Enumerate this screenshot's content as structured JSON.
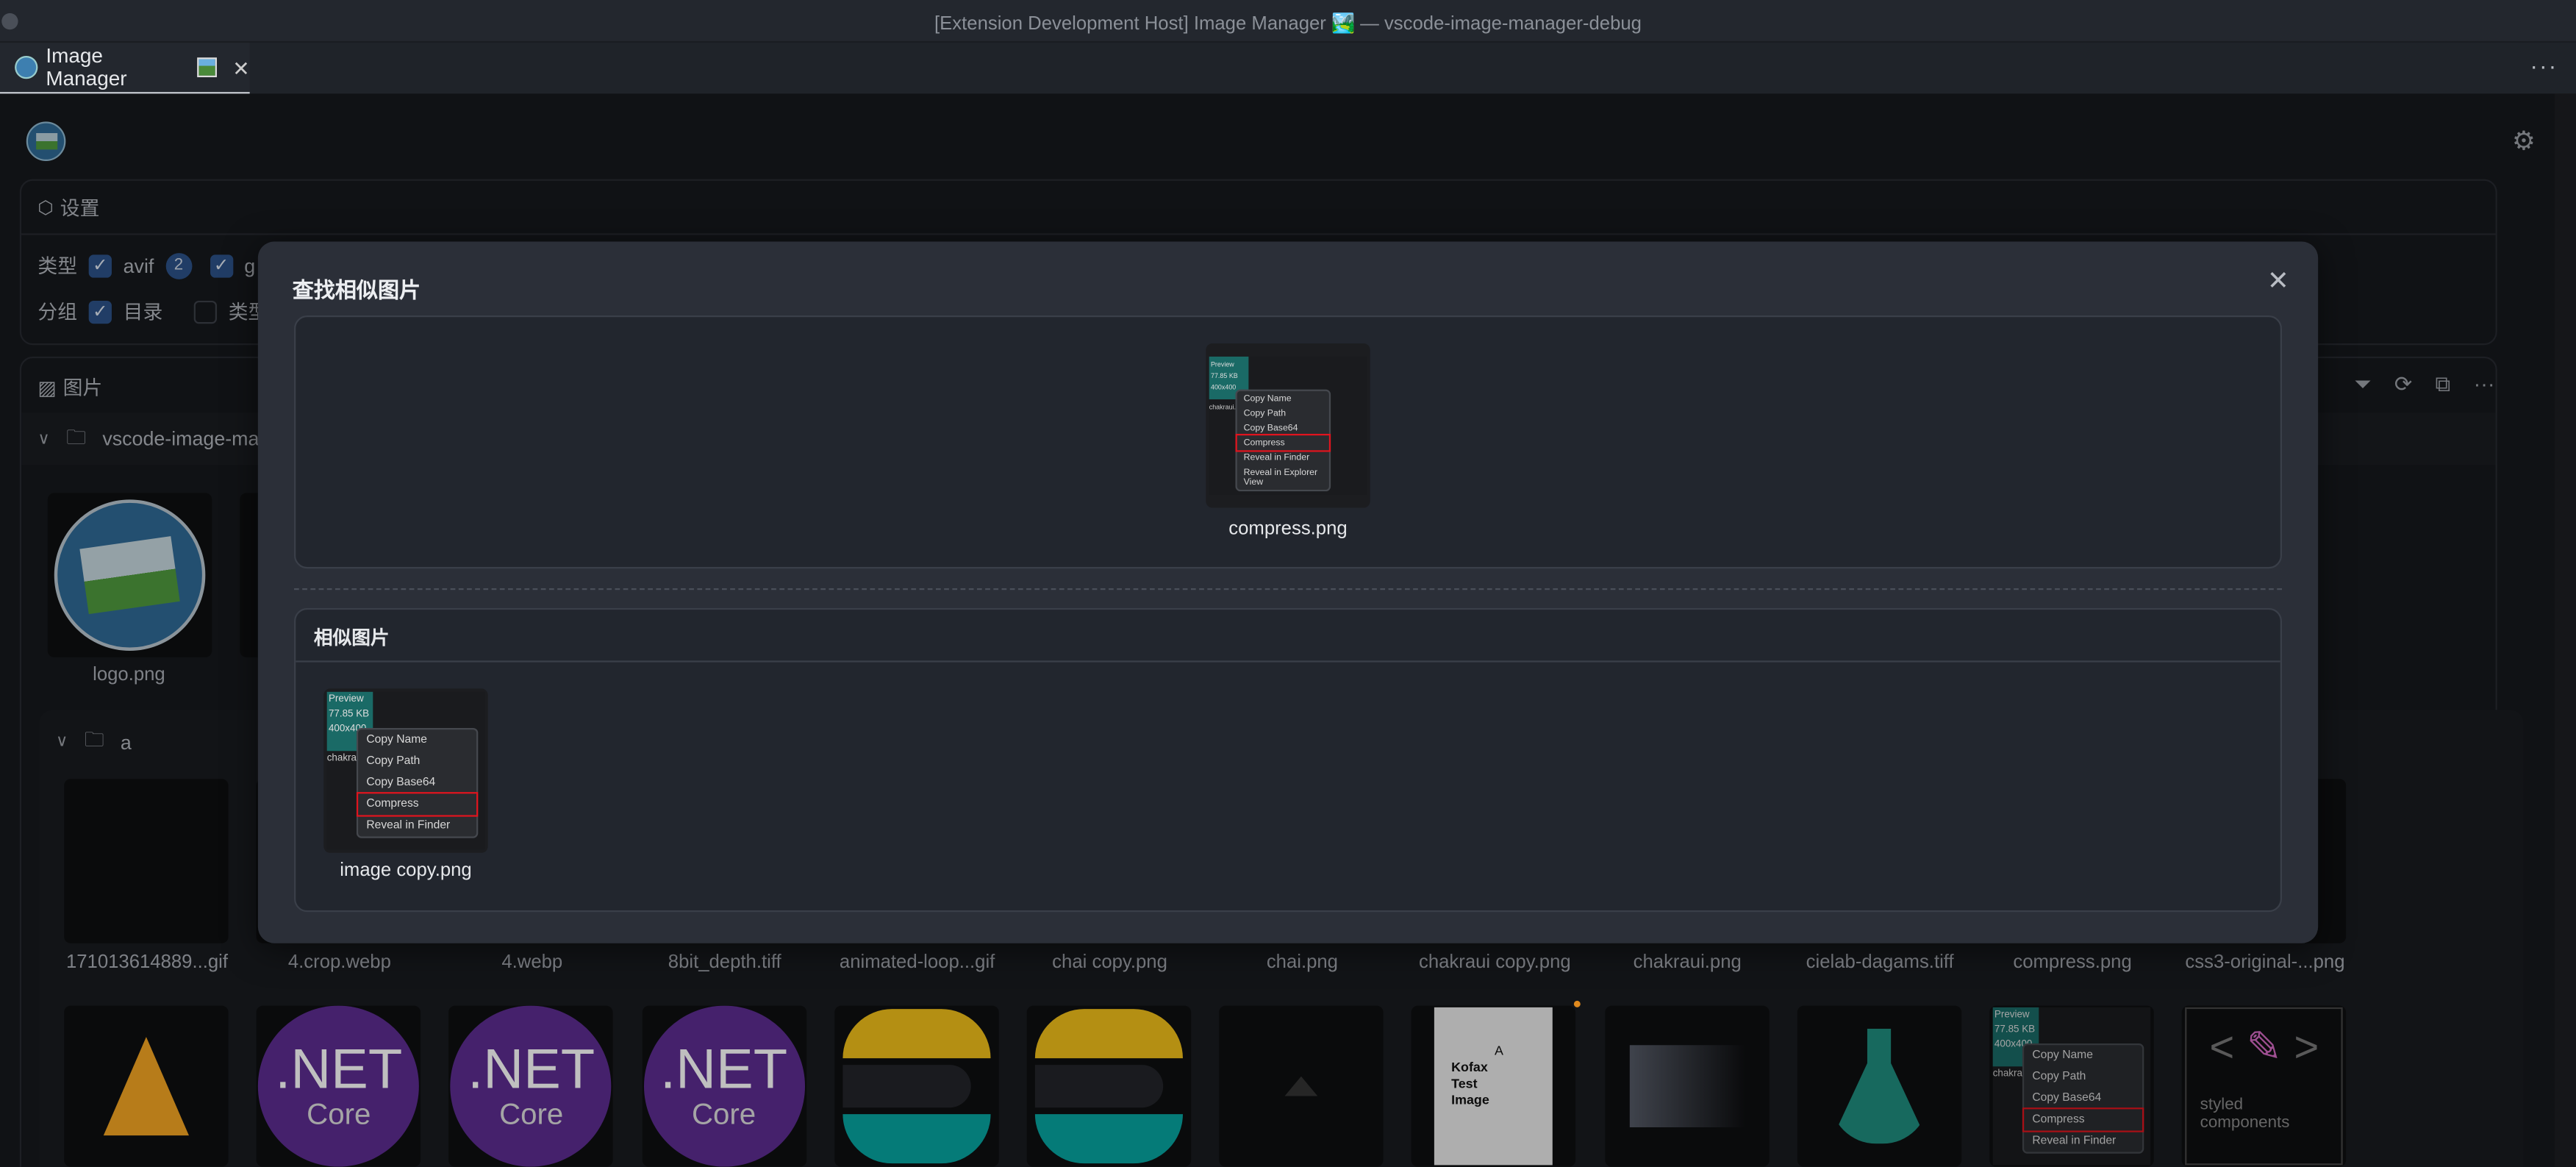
{
  "window": {
    "title": "[Extension Development Host] Image Manager 🏞️ — vscode-image-manager-debug"
  },
  "tab": {
    "label": "Image Manager",
    "icon": "image-manager-logo-icon"
  },
  "settings": {
    "title": "设置",
    "type_label": "类型",
    "types": [
      {
        "label": "avif",
        "count": "2",
        "checked": true
      },
      {
        "label": "g",
        "checked": true
      }
    ],
    "group_label": "分组",
    "groups": [
      {
        "label": "目录",
        "checked": true
      },
      {
        "label": "类型",
        "checked": false
      }
    ]
  },
  "images": {
    "title": "图片",
    "root_folder": "vscode-image-ma",
    "root_files": [
      "logo.png"
    ],
    "subfolder": "a",
    "subfolder_files": [
      "171013614889...gif",
      "4.crop.webp",
      "4.webp",
      "8bit_depth.tiff",
      "animated-loop...gif",
      "chai copy.png",
      "chai.png",
      "chakraui copy.png",
      "chakraui.png",
      "cielab-dagams.tiff",
      "compress.png",
      "css3-original-...png"
    ],
    "row2_thumbs": [
      "firebase",
      "NET Core",
      "NET Core",
      "NET Core",
      "elastic",
      "elastic",
      "triangle",
      "Kofax Test Image",
      "gradient",
      "flask",
      "compress",
      "styled components"
    ]
  },
  "net_core": {
    "top": ".NET",
    "bottom": "Core"
  },
  "kofax": {
    "l1": "Kofax",
    "l2": "Test",
    "l3": "Image",
    "letter": "A"
  },
  "styled": {
    "text": "styled components"
  },
  "modal": {
    "title": "查找相似图片",
    "source_file": "compress.png",
    "similar_title": "相似图片",
    "similar_files": [
      "image copy.png"
    ]
  },
  "screenshot_menu": {
    "preview": "Preview",
    "size": "77.85 KB",
    "dims": "400x400",
    "name": "chakraui.p",
    "items": [
      "Copy Name",
      "Copy Path",
      "Copy Base64",
      "Compress",
      "Reveal in Finder",
      "Reveal in Explorer View"
    ]
  },
  "colors": {
    "accent": "#2c5288",
    "highlight": "#e0141e",
    "modal_bg": "#2b2f38"
  }
}
